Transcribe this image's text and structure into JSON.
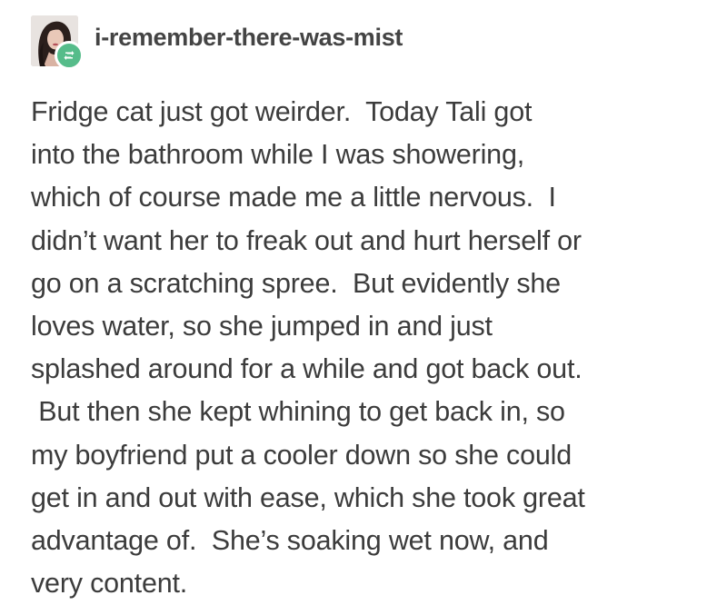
{
  "post": {
    "username": "i-remember-there-was-mist",
    "avatar_icon": "user-avatar-photo",
    "reblog_icon": "reblog-icon",
    "accent_color": "#56bc8a",
    "body_lines": [
      "Fridge cat just got weirder.  Today Tali got",
      "into the bathroom while I was showering,",
      "which of course made me a little nervous.  I",
      "didn’t want her to freak out and hurt herself or",
      "go on a scratching spree.  But evidently she",
      "loves water, so she jumped in and just",
      "splashed around for a while and got back out.",
      " But then she kept whining to get back in, so",
      "my boyfriend put a cooler down so she could",
      "get in and out with ease, which she took great",
      "advantage of.  She’s soaking wet now, and",
      "very content."
    ]
  }
}
